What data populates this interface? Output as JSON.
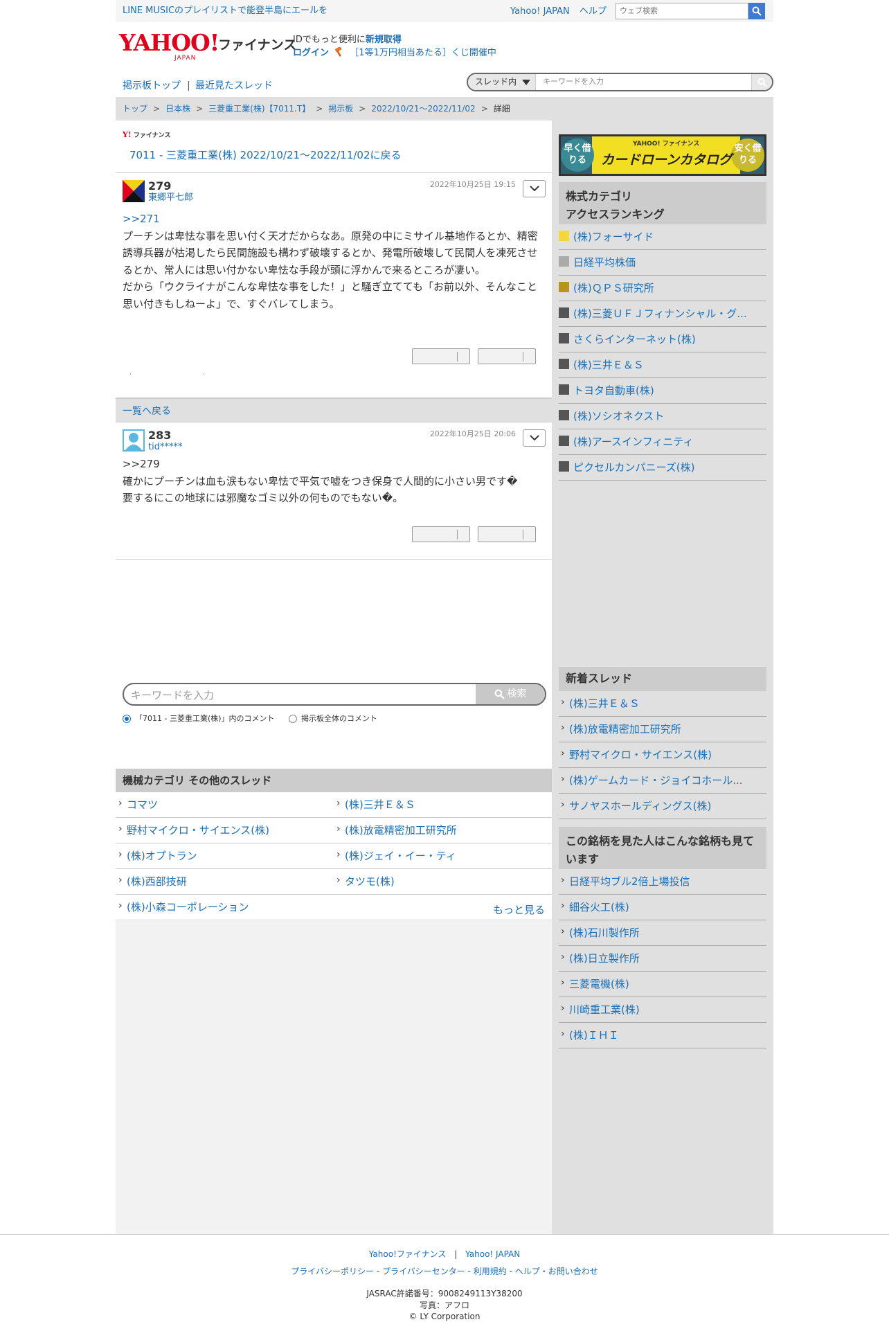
{
  "topbar": {
    "promo": "LINE MUSICのプレイリストで能登半島にエールを",
    "yahoo_japan": "Yahoo! JAPAN",
    "help": "ヘルプ",
    "web_search_placeholder": "ウェブ検索"
  },
  "header": {
    "logo_yahoo": "YAHOO!",
    "logo_japan": "JAPAN",
    "logo_finance": "ファイナンス",
    "id_text": "IDでもっと便利に",
    "signup": "新規取得",
    "login": "ログイン",
    "lottery": "［1等1万円相当あたる］くじ開催中"
  },
  "tabs": {
    "board_top": "掲示板トップ",
    "separator": "|",
    "recent": "最近見たスレッド",
    "scope": "スレッド内",
    "placeholder": "キーワードを入力"
  },
  "breadcrumb": {
    "items": [
      "トップ",
      "日本株",
      "三菱重工業(株)【7011.T】",
      "掲示板",
      "2022/10/21〜2022/11/02",
      "詳細"
    ],
    "sep": ">"
  },
  "thread": {
    "brand": "ファイナンス",
    "back_link": "7011 - 三菱重工業(株) 2022/10/21〜2022/11/02に戻る"
  },
  "posts": [
    {
      "no": "279",
      "user": "東郷平七郎",
      "date": "2022年10月25日 19:15",
      "ref": ">>271",
      "body": "プーチンは卑怯な事を思い付く天才だからなあ。原発の中にミサイル基地作るとか、精密誘導兵器が枯渇したら民間施設も構わず破壊するとか、発電所破壊して民間人を凍死させるとか、常人には思い付かない卑怯な手段が頭に浮かんで来るところが凄い。\nだから「ウクライナがこんな卑怯な事をした！」と騒ぎ立てても「お前以外、そんなこと思い付きもしねーよ」で、すぐバレてしまう。"
    },
    {
      "no": "283",
      "user": "tid*****",
      "date": "2022年10月25日 20:06",
      "ref": ">>279",
      "body": "確かにプーチンは血も涙もない卑怯で平気で嘘をつき保身で人間的に小さい男です�\n要するにこの地球には邪魔なゴミ以外の何ものでもない�。"
    }
  ],
  "back_to_list": "一覧へ戻る",
  "search": {
    "placeholder": "キーワードを入力",
    "button": "検索",
    "radio1": "「7011 - 三菱重工業(株)」内のコメント",
    "radio2": "掲示板全体のコメント"
  },
  "category": {
    "title": "機械カテゴリ  その他のスレッド",
    "items": [
      "コマツ",
      "(株)三井Ｅ＆Ｓ",
      "野村マイクロ・サイエンス(株)",
      "(株)放電精密加工研究所",
      "(株)オプトラン",
      "(株)ジェイ・イー・ティ",
      "(株)西部技研",
      "タツモ(株)",
      "(株)小森コーポレーション"
    ],
    "more": "もっと見る"
  },
  "ad": {
    "left": "早く借りる",
    "right": "安く借りる",
    "brand": "YAHOO! ファイナンス",
    "text": "カードローンカタログ"
  },
  "ranking": {
    "title": "株式カテゴリ\nアクセスランキング",
    "items": [
      {
        "name": "(株)フォーサイド",
        "color": "#f5d63d"
      },
      {
        "name": "日経平均株価",
        "color": "#aaaaaa"
      },
      {
        "name": "(株)ＱＰＳ研究所",
        "color": "#b8941a"
      },
      {
        "name": "(株)三菱ＵＦＪフィナンシャル・グ...",
        "color": "#555555"
      },
      {
        "name": "さくらインターネット(株)",
        "color": "#555555"
      },
      {
        "name": "(株)三井Ｅ＆Ｓ",
        "color": "#555555"
      },
      {
        "name": "トヨタ自動車(株)",
        "color": "#555555"
      },
      {
        "name": "(株)ソシオネクスト",
        "color": "#555555"
      },
      {
        "name": "(株)アースインフィニティ",
        "color": "#555555"
      },
      {
        "name": "ピクセルカンパニーズ(株)",
        "color": "#555555"
      }
    ]
  },
  "new_threads": {
    "title": "新着スレッド",
    "items": [
      "(株)三井Ｅ＆Ｓ",
      "(株)放電精密加工研究所",
      "野村マイクロ・サイエンス(株)",
      "(株)ゲームカード・ジョイコホール...",
      "サノヤスホールディングス(株)"
    ]
  },
  "also_viewed": {
    "title": "この銘柄を見た人はこんな銘柄も見ています",
    "items": [
      "日経平均ブル2倍上場投信",
      "細谷火工(株)",
      "(株)石川製作所",
      "(株)日立製作所",
      "三菱電機(株)",
      "川崎重工業(株)",
      "(株)ＩＨＩ"
    ]
  },
  "footer": {
    "fin": "Yahoo!ファイナンス",
    "sep": "|",
    "yj": "Yahoo! JAPAN",
    "links": "プライバシーポリシー - プライバシーセンター - 利用規約 - ヘルプ・お問い合わせ",
    "jasrac": "JASRAC許諾番号：9008249113Y38200",
    "photo": "写真：アフロ",
    "copyright": "© LY Corporation"
  }
}
